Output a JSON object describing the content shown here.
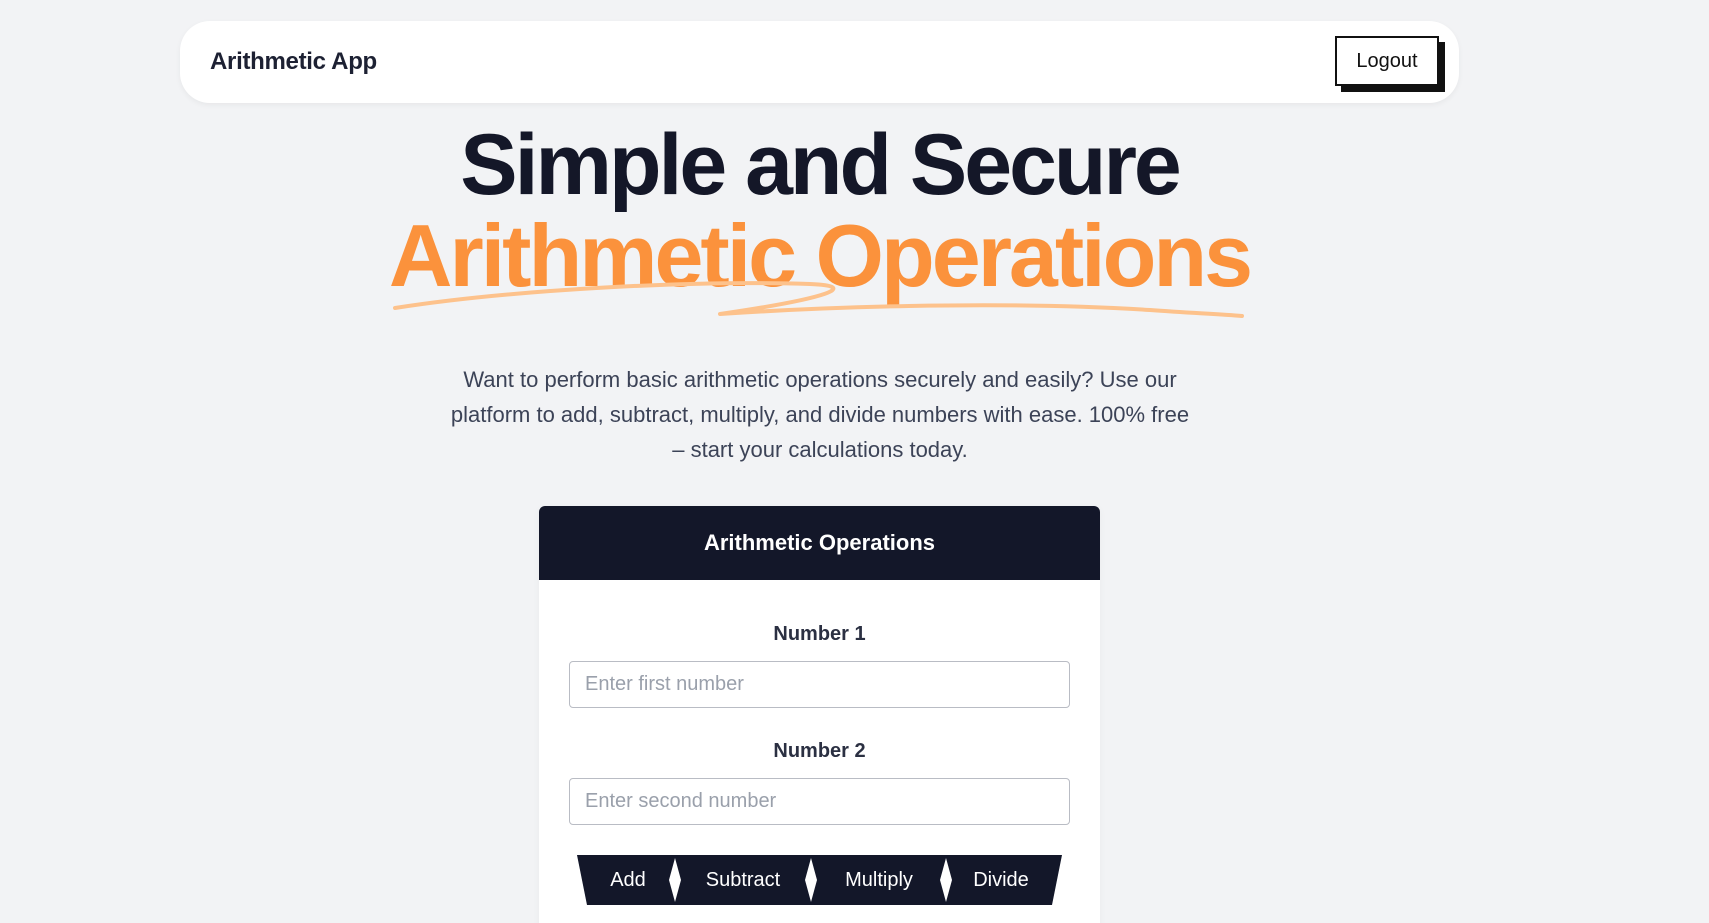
{
  "navbar": {
    "brand": "Arithmetic App",
    "logout_label": "Logout"
  },
  "hero": {
    "title_line1": "Simple and Secure",
    "title_line2": "Arithmetic Operations",
    "description": "Want to perform basic arithmetic operations securely and easily? Use our platform to add, subtract, multiply, and divide numbers with ease. 100% free – start your calculations today."
  },
  "card": {
    "title": "Arithmetic Operations",
    "number1": {
      "label": "Number 1",
      "value": "",
      "placeholder": "Enter first number"
    },
    "number2": {
      "label": "Number 2",
      "value": "",
      "placeholder": "Enter second number"
    },
    "operations": [
      "Add",
      "Subtract",
      "Multiply",
      "Divide"
    ]
  },
  "colors": {
    "background": "#f2f3f5",
    "dark": "#131729",
    "accent_orange": "#fb923c",
    "scribble": "#fdc28c"
  }
}
